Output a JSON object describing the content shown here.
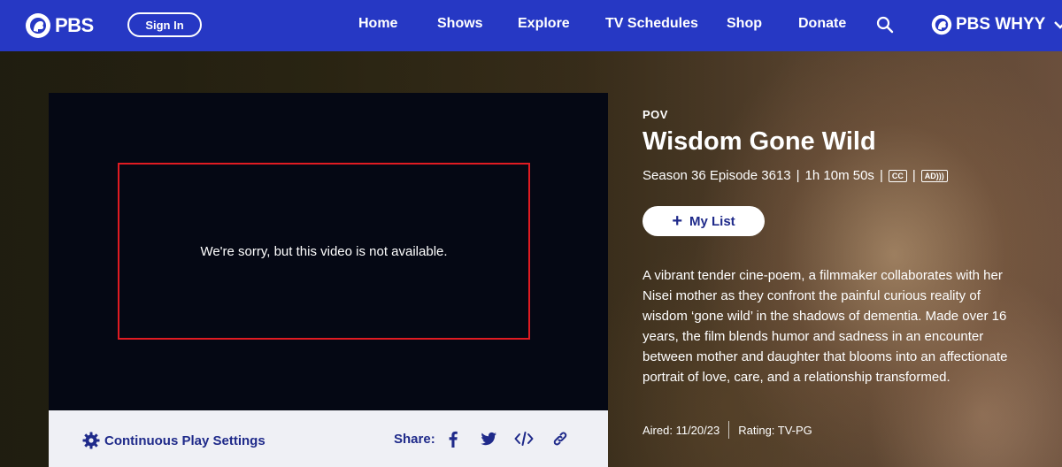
{
  "nav": {
    "logo": "PBS",
    "signin": "Sign In",
    "links": [
      "Home",
      "Shows",
      "Explore",
      "TV Schedules",
      "Shop",
      "Donate"
    ],
    "station": "PBS WHYY"
  },
  "player": {
    "error": "We're sorry, but this video is not available.",
    "continuous_play": "Continuous Play Settings",
    "share_label": "Share:"
  },
  "episode": {
    "show": "POV",
    "title": "Wisdom Gone Wild",
    "season_episode": "Season 36 Episode 3613",
    "duration": "1h 10m 50s",
    "cc_badge": "CC",
    "ad_badge": "AD)))",
    "mylist": "My List",
    "description": "A vibrant tender cine-poem, a filmmaker collaborates with her Nisei mother as they confront the painful curious reality of wisdom ‘gone wild’ in the shadows of dementia. Made over 16 years, the film blends humor and sadness in an encounter between mother and daughter that blooms into an affectionate portrait of love, care, and a relationship transformed.",
    "aired": "Aired: 11/20/23",
    "rating": "Rating: TV-PG"
  },
  "colors": {
    "nav_bg": "#2638c4",
    "accent": "#1f2a8a",
    "error_border": "#e01b22"
  }
}
